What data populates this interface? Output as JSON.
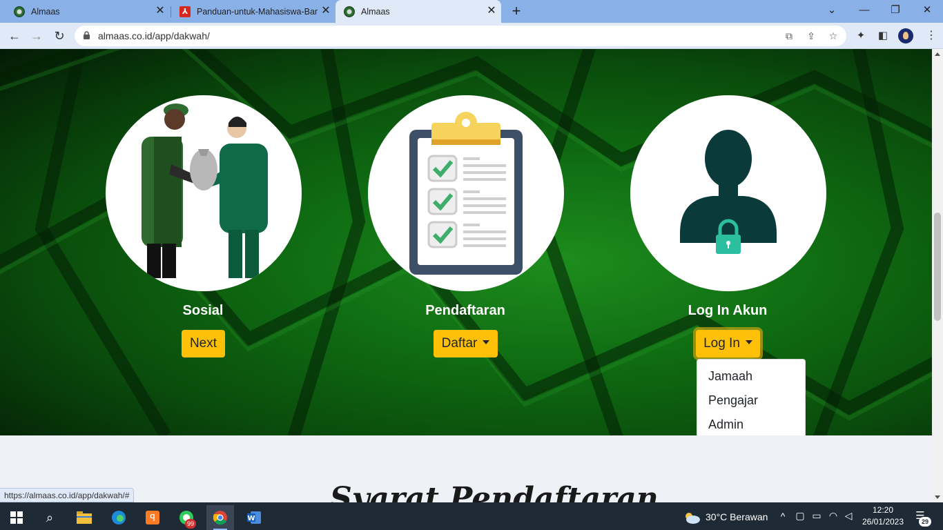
{
  "browser": {
    "tabs": [
      {
        "title": "Almaas",
        "icon": "almaas-icon",
        "active": false
      },
      {
        "title": "Panduan-untuk-Mahasiswa-Baru",
        "icon": "pdf-icon",
        "active": false
      },
      {
        "title": "Almaas",
        "icon": "almaas-icon",
        "active": true
      }
    ],
    "url": "almaas.co.id/app/dakwah/",
    "status_url": "https://almaas.co.id/app/dakwah/#"
  },
  "features": [
    {
      "title": "Sosial",
      "button": "Next",
      "image": "charity-illustration"
    },
    {
      "title": "Pendaftaran",
      "button": "Daftar",
      "image": "clipboard-checklist-illustration"
    },
    {
      "title": "Log In Akun",
      "button": "Log In",
      "image": "user-lock-illustration"
    }
  ],
  "login_dropdown": {
    "items": [
      "Jamaah",
      "Pengajar",
      "Admin"
    ]
  },
  "section": {
    "title": "Syarat Pendaftaran"
  },
  "taskbar": {
    "whatsapp_badge": "99",
    "weather": "30°C  Berawan",
    "time": "12:20",
    "date": "26/01/2023",
    "notifications": "29"
  },
  "colors": {
    "accent_button": "#ffc107",
    "hero_green": "#0f6b12",
    "icon_dark": "#0b3a3a"
  }
}
